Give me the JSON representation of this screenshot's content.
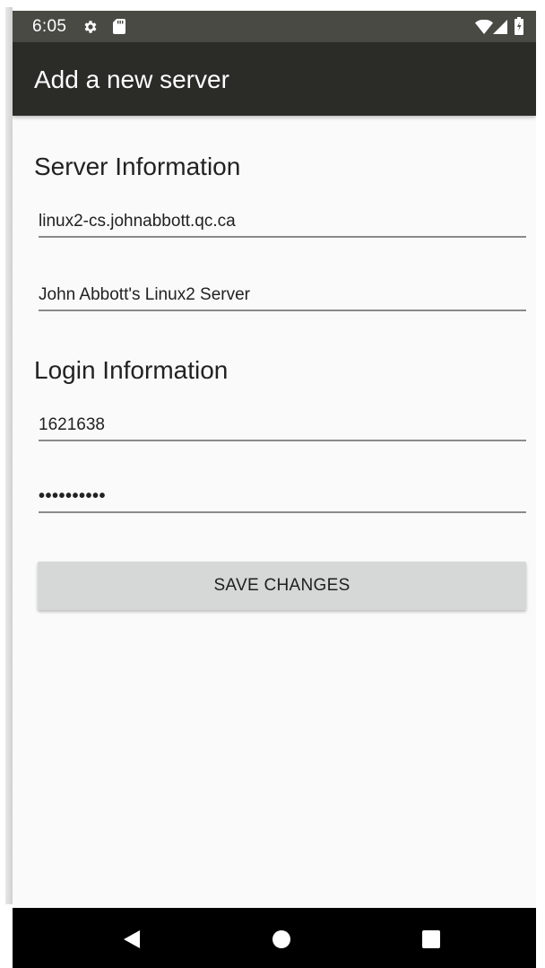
{
  "status_bar": {
    "time": "6:05",
    "icons": [
      "gear-icon",
      "sd-card-icon",
      "wifi-icon",
      "cell-signal-icon",
      "battery-icon"
    ]
  },
  "toolbar": {
    "title": "Add a new server"
  },
  "server_section": {
    "heading": "Server Information",
    "hostname_value": "linux2-cs.johnabbott.qc.ca",
    "server_name_value": "John Abbott's Linux2 Server"
  },
  "login_section": {
    "heading": "Login Information",
    "username_value": "1621638",
    "password_value": "••••••••••"
  },
  "actions": {
    "save_label": "SAVE CHANGES"
  },
  "nav_bar": {
    "icons": [
      "back-icon",
      "home-icon",
      "recents-icon"
    ]
  },
  "colors": {
    "status_bar": "#4a4a45",
    "toolbar": "#2b2b27",
    "background": "#fafafa",
    "button": "#d6d7d7",
    "nav_bar": "#000000"
  }
}
